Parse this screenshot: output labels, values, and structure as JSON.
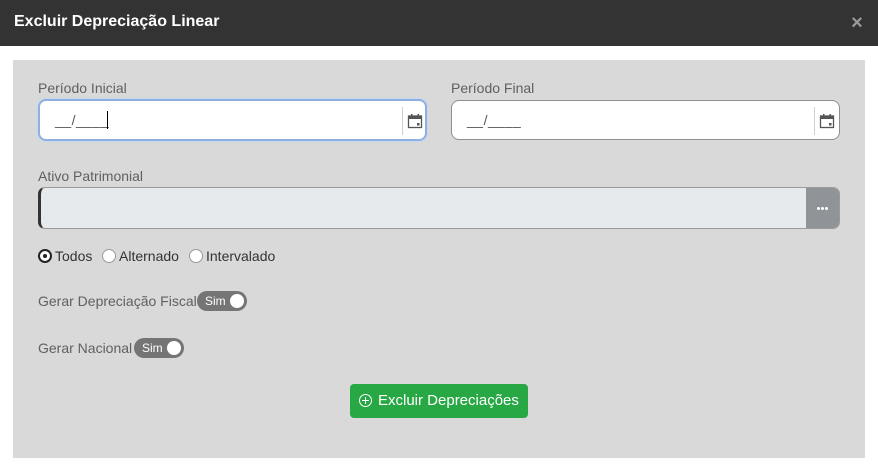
{
  "dialog": {
    "title": "Excluir Depreciação Linear",
    "close_icon": "close-icon"
  },
  "form": {
    "periodo_inicial": {
      "label": "Período Inicial",
      "value": "__/____"
    },
    "periodo_final": {
      "label": "Período Final",
      "value": "__/____"
    },
    "ativo": {
      "label": "Ativo Patrimonial",
      "value": ""
    },
    "radio": {
      "options": [
        "Todos",
        "Alternado",
        "Intervalado"
      ],
      "selected": "Todos"
    },
    "depreciacao_fiscal": {
      "label": "Gerar Depreciação Fiscal",
      "toggle": "Sim"
    },
    "nacional": {
      "label": "Gerar Nacional",
      "toggle": "Sim"
    }
  },
  "action": {
    "label": "Excluir Depreciações"
  },
  "colors": {
    "header": "#333333",
    "panel": "#d9d9d9",
    "primary": "#28a745",
    "toggle": "#757575"
  }
}
